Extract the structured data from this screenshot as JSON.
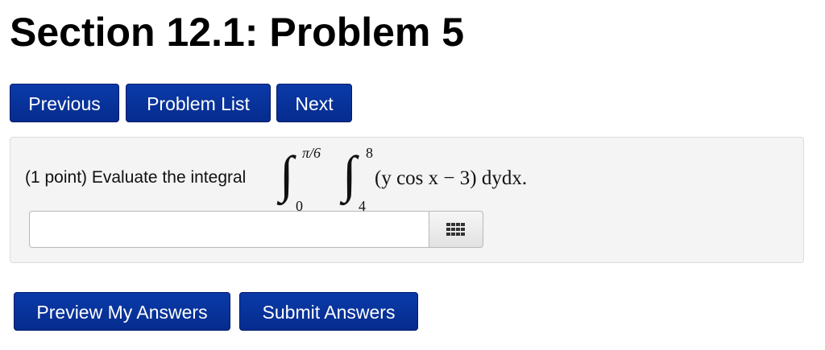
{
  "page": {
    "title": "Section 12.1: Problem 5"
  },
  "nav": {
    "previous_label": "Previous",
    "problem_list_label": "Problem List",
    "next_label": "Next"
  },
  "problem": {
    "prompt": "(1 point) Evaluate the integral",
    "outer_integral": {
      "lower": "0",
      "upper": "π/6"
    },
    "inner_integral": {
      "lower": "4",
      "upper": "8"
    },
    "integrand": "(y cos x − 3) dydx.",
    "answer": {
      "value": "",
      "placeholder": ""
    },
    "palette_icon": "keypad-grid-icon"
  },
  "actions": {
    "preview_label": "Preview My Answers",
    "submit_label": "Submit Answers"
  },
  "colors": {
    "button_bg": "#062c8e",
    "panel_bg": "#f4f4f4"
  }
}
